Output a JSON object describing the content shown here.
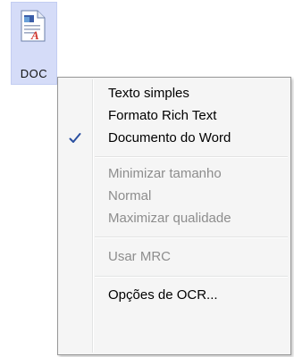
{
  "doc_tile": {
    "label": "DOC",
    "icon": "word-document-icon"
  },
  "menu": {
    "items": [
      {
        "label": "Texto simples",
        "checked": false,
        "enabled": true
      },
      {
        "label": "Formato Rich Text",
        "checked": false,
        "enabled": true
      },
      {
        "label": "Documento do Word",
        "checked": true,
        "enabled": true
      },
      {
        "label": "Minimizar tamanho",
        "checked": false,
        "enabled": false
      },
      {
        "label": "Normal",
        "checked": false,
        "enabled": false
      },
      {
        "label": "Maximizar qualidade",
        "checked": false,
        "enabled": false
      },
      {
        "label": "Usar MRC",
        "checked": false,
        "enabled": false
      },
      {
        "label": "Opções de OCR...",
        "checked": false,
        "enabled": true
      }
    ],
    "check_icon": "checkmark-icon",
    "accent_color": "#2a4fa0"
  }
}
